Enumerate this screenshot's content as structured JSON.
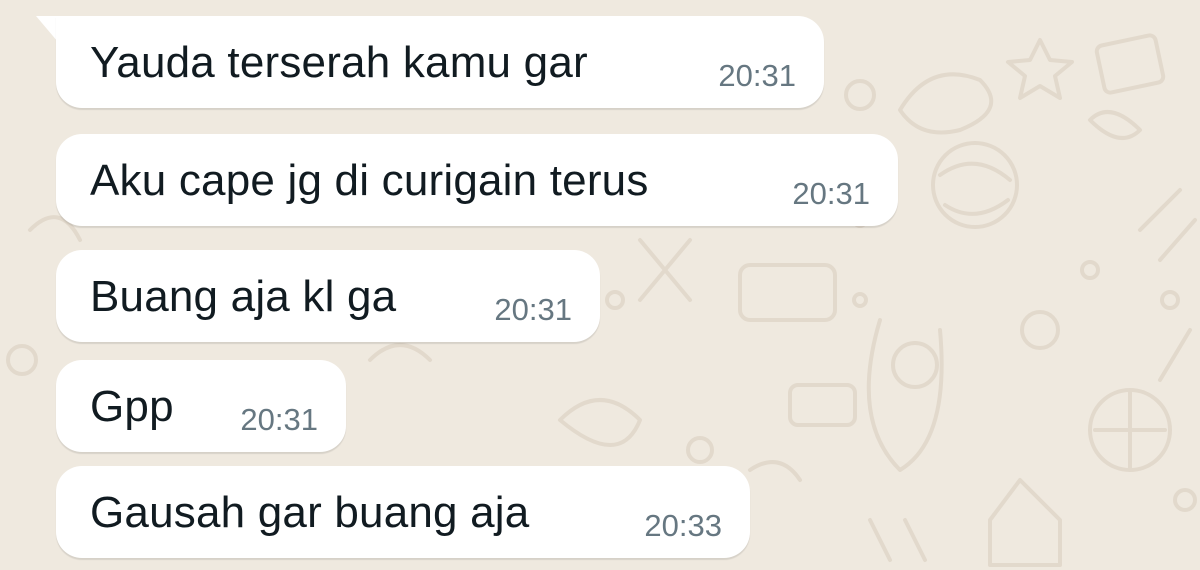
{
  "chat": {
    "messages": [
      {
        "text": "Yauda terserah kamu gar",
        "time": "20:31"
      },
      {
        "text": "Aku cape jg di curigain terus",
        "time": "20:31"
      },
      {
        "text": "Buang aja kl ga",
        "time": "20:31"
      },
      {
        "text": "Gpp",
        "time": "20:31"
      },
      {
        "text": "Gausah gar buang aja",
        "time": "20:33"
      }
    ]
  },
  "colors": {
    "background": "#efe9df",
    "bubble": "#ffffff",
    "text": "#111b21",
    "timestamp": "#667781",
    "doodle": "#e2d9cc"
  }
}
